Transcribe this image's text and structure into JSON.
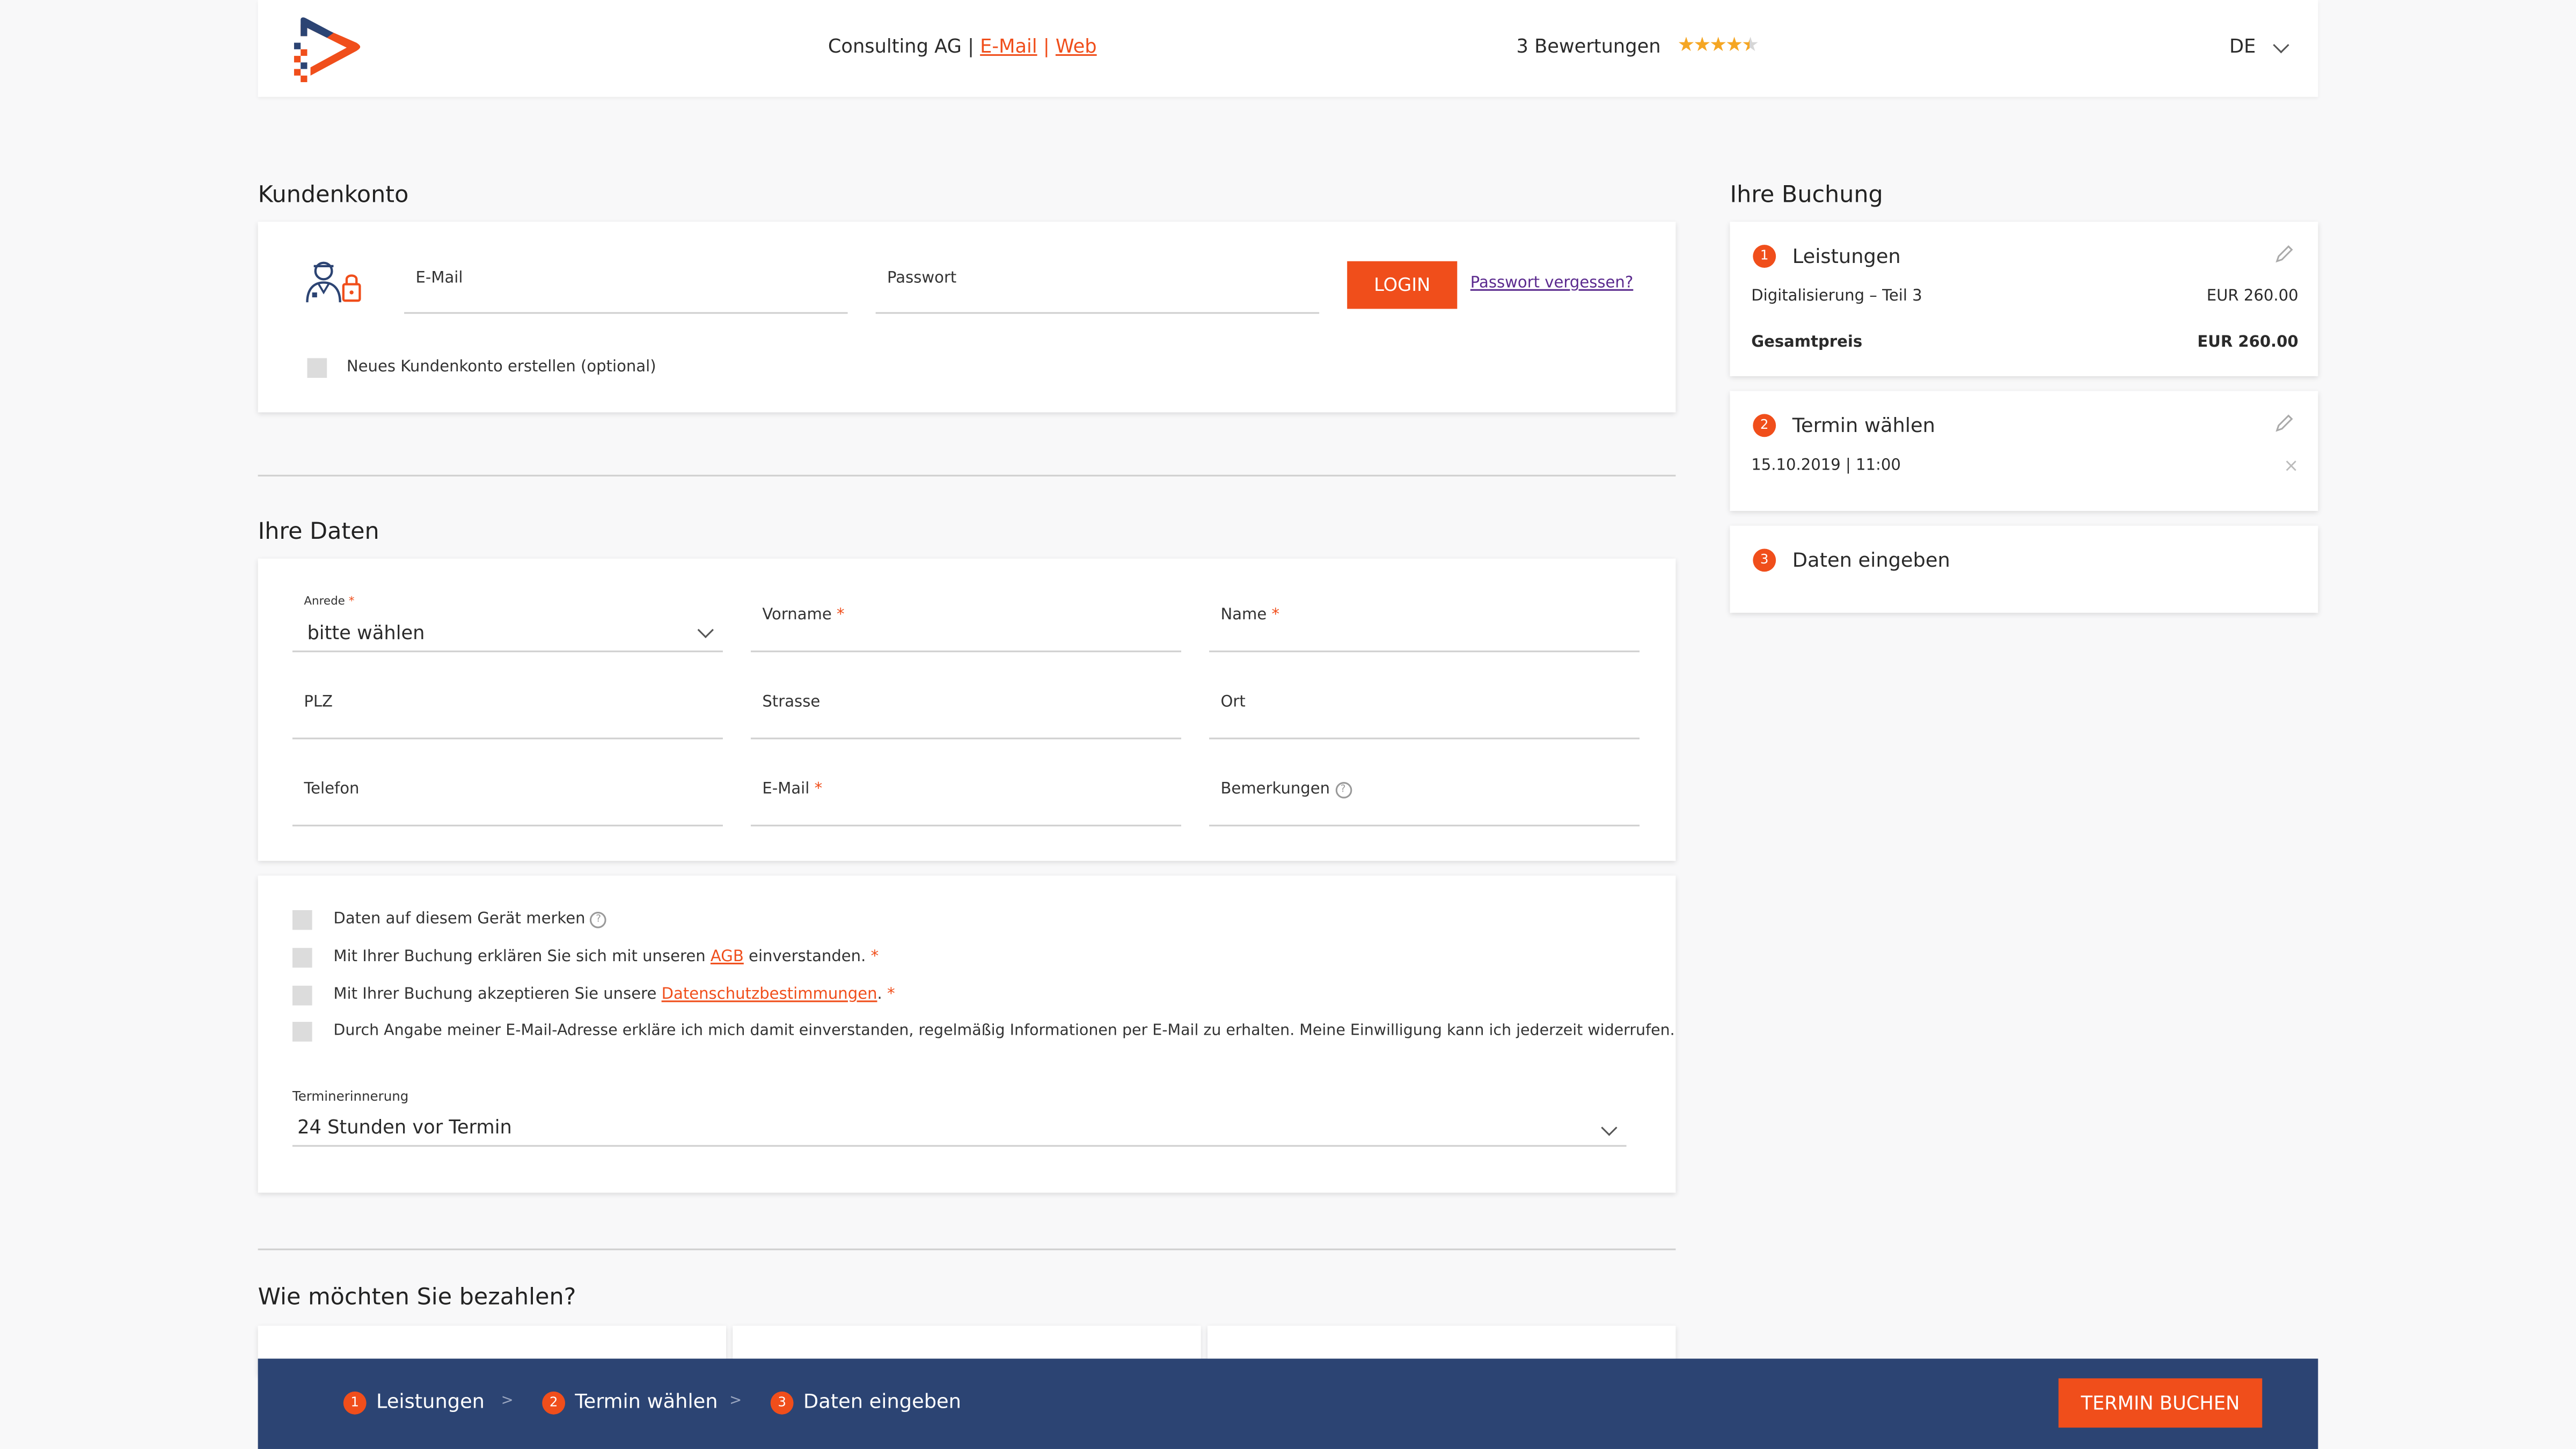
{
  "header": {
    "company": "Consulting AG |",
    "email_link": "E-Mail",
    "sep": "|",
    "web_link": "Web",
    "reviews": "3 Bewertungen",
    "rating": 4.5,
    "language": "DE"
  },
  "account": {
    "title": "Kundenkonto",
    "email_label": "E-Mail",
    "password_label": "Passwort",
    "login_button": "LOGIN",
    "forgot_link": "Passwort vergessen?",
    "create_account": "Neues Kundenkonto erstellen (optional)"
  },
  "your_data": {
    "title": "Ihre Daten",
    "salutation_label": "Anrede",
    "salutation_value": "bitte wählen",
    "firstname_label": "Vorname",
    "name_label": "Name",
    "zip_label": "PLZ",
    "street_label": "Strasse",
    "city_label": "Ort",
    "phone_label": "Telefon",
    "email_label": "E-Mail",
    "remarks_label": "Bemerkungen",
    "required_mark": "*"
  },
  "consents": {
    "remember": "Daten auf diesem Gerät merken",
    "agb_pre": "Mit Ihrer Buchung erklären Sie sich mit unseren ",
    "agb_link": "AGB",
    "agb_post": " einverstanden.",
    "privacy_pre": "Mit Ihrer Buchung akzeptieren Sie unsere ",
    "privacy_link": "Datenschutzbestimmungen",
    "privacy_post": ".",
    "newsletter": "Durch Angabe meiner E-Mail-Adresse erkläre ich mich damit einverstanden, regelmäßig Informationen per E-Mail zu erhalten. Meine Einwilligung kann ich jederzeit widerrufen.",
    "reminder_label": "Terminerinnerung",
    "reminder_value": "24 Stunden vor Termin"
  },
  "payment": {
    "title": "Wie möchten Sie bezahlen?"
  },
  "booking": {
    "title": "Ihre Buchung",
    "step1_num": "1",
    "step1_title": "Leistungen",
    "service_name": "Digitalisierung – Teil 3",
    "service_price": "EUR 260.00",
    "total_label": "Gesamtpreis",
    "total_price": "EUR 260.00",
    "step2_num": "2",
    "step2_title": "Termin wählen",
    "appointment": "15.10.2019 | 11:00",
    "step3_num": "3",
    "step3_title": "Daten eingeben"
  },
  "footer": {
    "step1_num": "1",
    "step1": "Leistungen",
    "step2_num": "2",
    "step2": "Termin wählen",
    "step3_num": "3",
    "step3": "Daten eingeben",
    "arrow": ">",
    "book_button": "TERMIN BUCHEN"
  },
  "colors": {
    "accent": "#f04e1b",
    "footer_bg": "#2c4473",
    "link_purple": "#5b2a8e"
  }
}
